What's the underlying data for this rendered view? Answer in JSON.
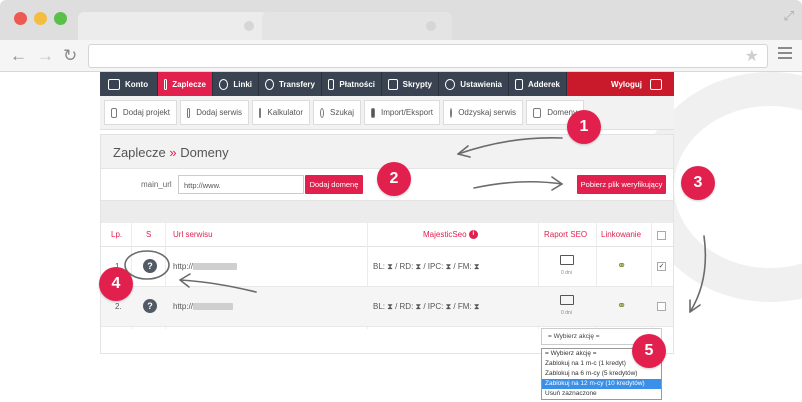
{
  "top_nav": [
    {
      "label": "Konto",
      "icon": "user-icon"
    },
    {
      "label": "Zaplecze",
      "icon": "zaplecze-icon",
      "active": true
    },
    {
      "label": "Linki",
      "icon": "link-icon"
    },
    {
      "label": "Transfery",
      "icon": "transfer-icon"
    },
    {
      "label": "Płatności",
      "icon": "bank-icon"
    },
    {
      "label": "Skrypty",
      "icon": "download-icon"
    },
    {
      "label": "Ustawienia",
      "icon": "gear-icon"
    },
    {
      "label": "Adderek",
      "icon": "external-link-icon"
    },
    {
      "label": "Wyloguj",
      "icon": "logout-icon"
    }
  ],
  "sub_nav": [
    {
      "label": "Dodaj projekt",
      "icon": "add-project-icon"
    },
    {
      "label": "Dodaj serwis",
      "icon": "add-service-icon"
    },
    {
      "label": "Kalkulator",
      "icon": "calculator-icon"
    },
    {
      "label": "Szukaj",
      "icon": "search-icon"
    },
    {
      "label": "Import/Eksport",
      "icon": "import-export-icon"
    },
    {
      "label": "Odzyskaj serwis",
      "icon": "recover-icon"
    },
    {
      "label": "Domeny",
      "icon": "domains-icon"
    }
  ],
  "page": {
    "crumb": "Zaplecze",
    "sep": " » ",
    "title": "Domeny"
  },
  "form": {
    "label": "main_url",
    "input_value": "http://www.",
    "add_button": "Dodaj domenę",
    "verify_button": "Pobierz plik weryfikujący"
  },
  "table": {
    "headers": {
      "lp": "Lp.",
      "s": "S",
      "url": "Url serwisu",
      "majestic": "MajesticSeo",
      "seo": "Raport SEO",
      "link": "Linkowanie"
    },
    "rows": [
      {
        "lp": "1.",
        "status": "?",
        "url": "http://",
        "metrics": "BL: ⧗ / RD: ⧗ / IPC: ⧗ / FM: ⧗",
        "seo_days": "0 dni",
        "checked": true
      },
      {
        "lp": "2.",
        "status": "?",
        "url": "http://",
        "metrics": "BL: ⧗ / RD: ⧗ / IPC: ⧗ / FM: ⧗",
        "seo_days": "0 dni",
        "checked": false
      }
    ]
  },
  "action_select": {
    "selected": "= Wybierz akcję =",
    "options": [
      "= Wybierz akcję =",
      "Zablokuj na 1 m-c (1 kredyt)",
      "Zablokuj na 6 m-cy (5 kredytów)",
      "Zablokuj na 12 m-cy (10 kredytów)",
      "Usuń zaznaczone"
    ],
    "highlighted_index": 3
  },
  "markers": [
    "1",
    "2",
    "3",
    "4",
    "5"
  ],
  "colors": {
    "accent": "#e2204e",
    "nav": "#3a4351",
    "logout": "#c81a2b",
    "highlight": "#3a8fe8"
  }
}
